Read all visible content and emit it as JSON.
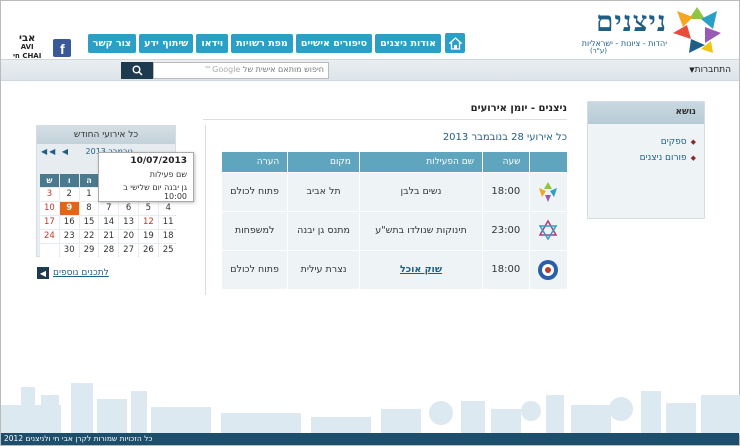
{
  "brand": {
    "name": "ניצנים",
    "tagline": "יהדות - ציונות - ישראליות",
    "tagline_reg": "(ע\"ר)"
  },
  "nav": {
    "items": [
      "אודות ניצנים",
      "סיפורים אישיים",
      "מפת רשויות",
      "וידאו",
      "שיתוף ידע",
      "צור קשר"
    ]
  },
  "social": {
    "avichai_top": "אבי",
    "avichai_mid": "AVI",
    "avichai_bottom": "CHAI",
    "avichai_sub": "חי"
  },
  "search": {
    "placeholder": "חיפוש מותאם אישית של",
    "google_label": "Google™"
  },
  "connect_label": "התחברות",
  "sidebar": {
    "header": "נושא",
    "items": [
      "ספקים",
      "פורום ניצנים"
    ]
  },
  "main": {
    "title": "ניצנים - יומן אירועים",
    "subtitle": "כל אירועי 28 בנובמבר 2013",
    "columns": [
      "שעה",
      "שם הפעילות",
      "מקום",
      "הערה"
    ],
    "rows": [
      {
        "time": "18:00",
        "name": "נשים בלבן",
        "place": "תל אביב",
        "note": "פתוח לכולם",
        "logo_color": "#6cb33f",
        "link": false
      },
      {
        "time": "23:00",
        "name": "תינוקות שנולדו בתש\"ע",
        "place": "מתנס גן יבנה",
        "note": "למשפחות",
        "logo_color": "#b03a7a",
        "link": false
      },
      {
        "time": "18:00",
        "name": "שוק אוכל",
        "place": "נצרת עילית",
        "note": "פתוח לכולם",
        "logo_color": "#2a5ea8",
        "link": true
      }
    ]
  },
  "calendar": {
    "header": "כל אירועי החודש",
    "month_label": "נובמבר 2013",
    "hebrew_sub": "תשע\"ד",
    "day_headers": [
      "ש",
      "ו",
      "ה",
      "ד",
      "ג",
      "ב",
      "א"
    ],
    "weeks": [
      [
        "",
        "1",
        "",
        "",
        "",
        "",
        ""
      ],
      [
        "2",
        "1",
        "",
        "",
        "",
        "",
        ""
      ],
      [
        "3",
        "2",
        "1",
        "",
        "",
        "",
        ""
      ]
    ],
    "grid": [
      [
        "ש",
        "ו",
        "ה",
        "ד",
        "ג",
        "ב",
        "א"
      ],
      [
        "3",
        "2",
        "1",
        "",
        "",
        "",
        ""
      ],
      [
        "10",
        "9",
        "8",
        "7",
        "6",
        "5",
        "4"
      ],
      [
        "17",
        "16",
        "15",
        "14",
        "13",
        "12",
        "11"
      ],
      [
        "24",
        "23",
        "22",
        "21",
        "20",
        "19",
        "18"
      ],
      [
        "",
        "30",
        "29",
        "28",
        "27",
        "26",
        "25"
      ]
    ],
    "more_label": "לתכנים נוספים"
  },
  "tooltip": {
    "date": "10/07/2013",
    "activity_label": "שם פעילות",
    "detail": "גן יבנה יום שלישי ב 10:00"
  },
  "footer": {
    "text": "כל הזכויות שמורות לקרן אבי חי ולניצנים 2012"
  },
  "colors": {
    "primary": "#2aa0c6",
    "dark": "#1d4e6b",
    "accent": "#e0651e"
  }
}
